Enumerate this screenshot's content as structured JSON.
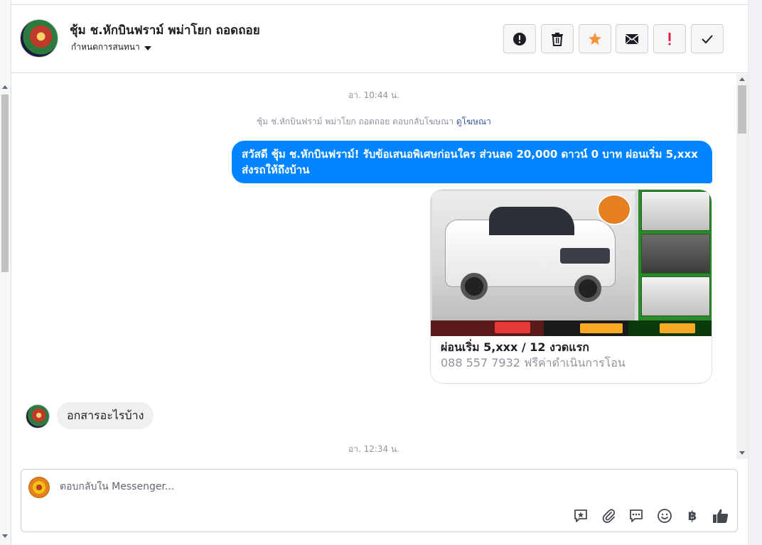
{
  "header": {
    "contact_name": "ชุ้ม ช.หักบินฟราม์ พม่าโยก ถอดถอย",
    "subtitle": "กำหนดการสนทนา",
    "buttons": [
      {
        "name": "report-button",
        "icon": "alert-circle-icon"
      },
      {
        "name": "delete-button",
        "icon": "trash-icon"
      },
      {
        "name": "star-button",
        "icon": "star-icon"
      },
      {
        "name": "email-button",
        "icon": "envelope-icon"
      },
      {
        "name": "important-button",
        "icon": "exclamation-icon"
      },
      {
        "name": "done-button",
        "icon": "checkmark-icon"
      }
    ],
    "star_color": "#f7923a",
    "important_color": "#e41e3f"
  },
  "thread": {
    "timestamp_1": "อา. 10:44 น.",
    "ad_reference": {
      "text": "ชุ้ม ช่.หักบินฟราม์ พม่าโยก ถอดถอย ตอบกลับโฆษณา",
      "link": "ดูโฆษณา"
    },
    "outgoing_message": "สวัสดี ชุ้ม ช.หักบินฟราม์! รับข้อเสนอพิเศษก่อนใคร ส่วนลด 20,000 ดาวน์ 0 บาท ผ่อนเริ่ม 5,xxx ส่งรถให้ถึงบ้าน",
    "outgoing_color": "#0084ff",
    "ad_card": {
      "title": "ผ่อนเริ่ม 5,xxx / 12 งวดแรก",
      "description": "088 557 7932 ฟรีค่าดำเนินการโอน"
    },
    "incoming_message": "อกสารอะไรบ้าง",
    "timestamp_2": "อา. 12:34 น."
  },
  "composer": {
    "placeholder": "ตอบกลับใน Messenger...",
    "tools": [
      "saved-reply-icon",
      "attachment-icon",
      "quick-reply-icon",
      "emoji-icon",
      "baht-icon",
      "like-icon"
    ],
    "baht_symbol": "฿"
  }
}
